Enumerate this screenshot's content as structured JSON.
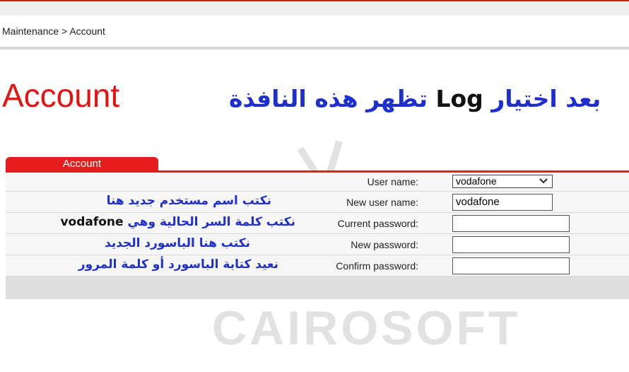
{
  "breadcrumb": "Maintenance > Account",
  "page_title": "Account",
  "arabic_heading": {
    "part1": "بعد اختيار",
    "part2": "Log",
    "part3": "تظهر هذه النافذة"
  },
  "tab_label": "Account",
  "form": {
    "user_name": {
      "label": "User name:",
      "value": "vodafone"
    },
    "new_user_name": {
      "label": "New user name:",
      "value": "vodafone",
      "note": "نكتب اسم مستخدم جديد هنا"
    },
    "current_password": {
      "label": "Current password:",
      "value": "",
      "note": "نكتب كلمة السر الحالية وهي",
      "note_value": "vodafone"
    },
    "new_password": {
      "label": "New password:",
      "value": "",
      "note": "نكتب هنا الباسورد الجديد"
    },
    "confirm_password": {
      "label": "Confirm password:",
      "value": "",
      "note": "نعيد كتابة الباسورد أو كلمة المرور"
    }
  },
  "watermark": "CAIROSOFT",
  "colors": {
    "accent_red": "#e51d1d",
    "note_blue": "#1e2fd0"
  }
}
